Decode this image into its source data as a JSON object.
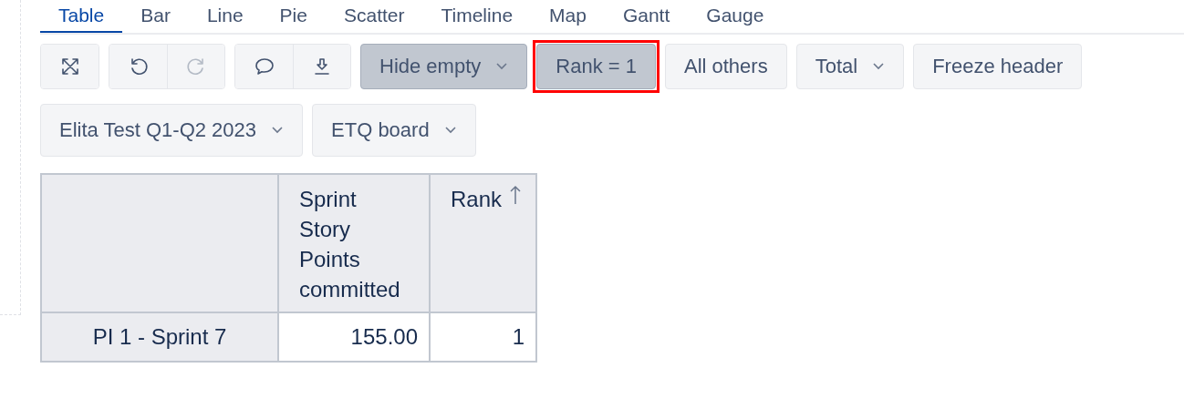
{
  "tabs": [
    {
      "label": "Table",
      "selected": true
    },
    {
      "label": "Bar",
      "selected": false
    },
    {
      "label": "Line",
      "selected": false
    },
    {
      "label": "Pie",
      "selected": false
    },
    {
      "label": "Scatter",
      "selected": false
    },
    {
      "label": "Timeline",
      "selected": false
    },
    {
      "label": "Map",
      "selected": false
    },
    {
      "label": "Gantt",
      "selected": false
    },
    {
      "label": "Gauge",
      "selected": false
    }
  ],
  "toolbar": {
    "icon_groups": [
      [
        {
          "kind": "expand",
          "disabled": false
        }
      ],
      [
        {
          "kind": "undo",
          "disabled": false
        },
        {
          "kind": "redo",
          "disabled": true
        }
      ],
      [
        {
          "kind": "comment",
          "disabled": false
        },
        {
          "kind": "download",
          "disabled": false
        }
      ]
    ],
    "buttons": [
      {
        "label": "Hide empty",
        "selected": true,
        "dropdown": true,
        "highlighted": false
      },
      {
        "label": "Rank = 1",
        "selected": true,
        "dropdown": false,
        "highlighted": true
      },
      {
        "label": "All others",
        "selected": false,
        "dropdown": false,
        "highlighted": false
      },
      {
        "label": "Total",
        "selected": false,
        "dropdown": true,
        "highlighted": false
      },
      {
        "label": "Freeze header",
        "selected": false,
        "dropdown": false,
        "highlighted": false
      }
    ]
  },
  "filters": [
    {
      "label": "Elita Test Q1-Q2 2023"
    },
    {
      "label": "ETQ board"
    }
  ],
  "table": {
    "columns": [
      {
        "label": "Sprint Story Points committed",
        "sorted": false
      },
      {
        "label": "Rank",
        "sorted": true
      }
    ],
    "rows": [
      {
        "header": "PI 1 - Sprint 7",
        "cells": [
          "155.00",
          "1"
        ]
      }
    ]
  }
}
